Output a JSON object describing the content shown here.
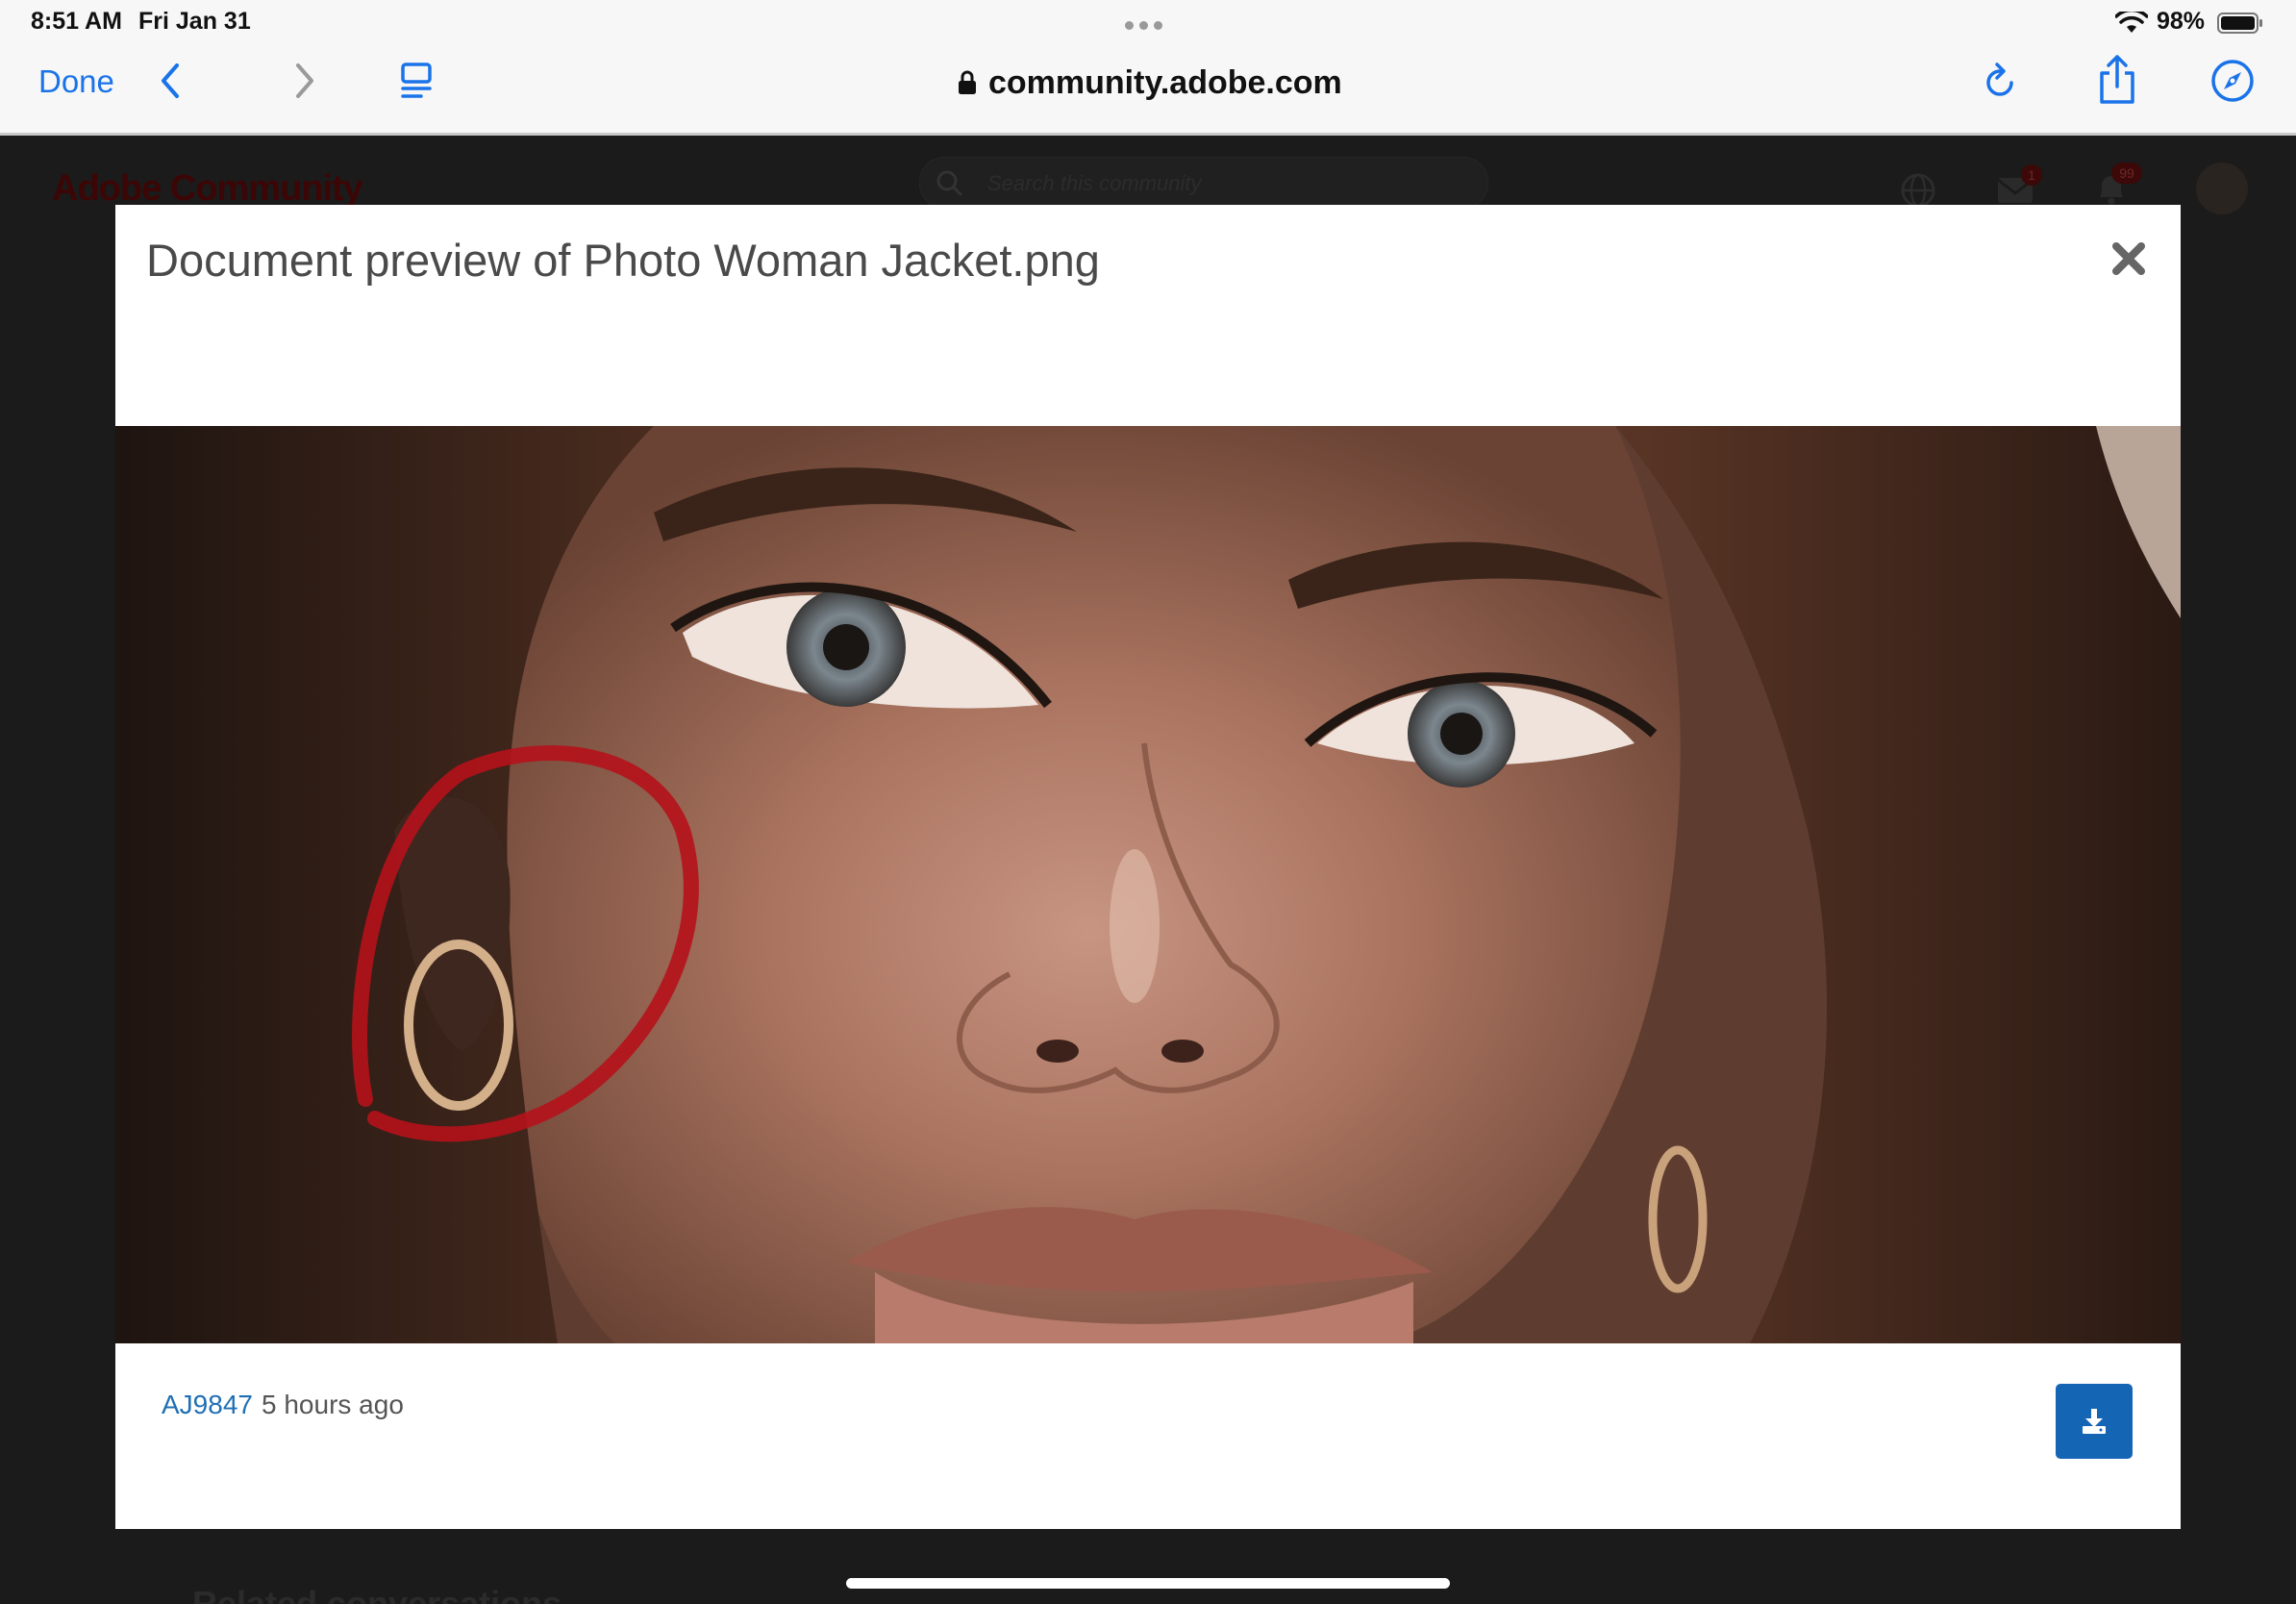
{
  "status_bar": {
    "time": "8:51 AM",
    "date": "Fri Jan 31",
    "battery": "98%",
    "icons": [
      "wifi-icon",
      "battery-icon"
    ]
  },
  "toolbar": {
    "done_label": "Done",
    "url": "community.adobe.com",
    "accent_color": "#1a73e8",
    "icons": [
      "back-icon",
      "forward-icon",
      "reader-icon",
      "lock-icon",
      "reload-icon",
      "share-icon",
      "compass-icon"
    ]
  },
  "background_page": {
    "logo_text": "Adobe Community",
    "search_placeholder": "Search this community",
    "mail_badge": "1",
    "notification_badge": "99",
    "bottom_heading": "Related conversations"
  },
  "modal": {
    "title": "Document preview of Photo Woman Jacket.png",
    "author": "AJ9847",
    "posted": "5 hours ago",
    "image_description_icon": "preview-image",
    "download_color": "#1565b5"
  }
}
